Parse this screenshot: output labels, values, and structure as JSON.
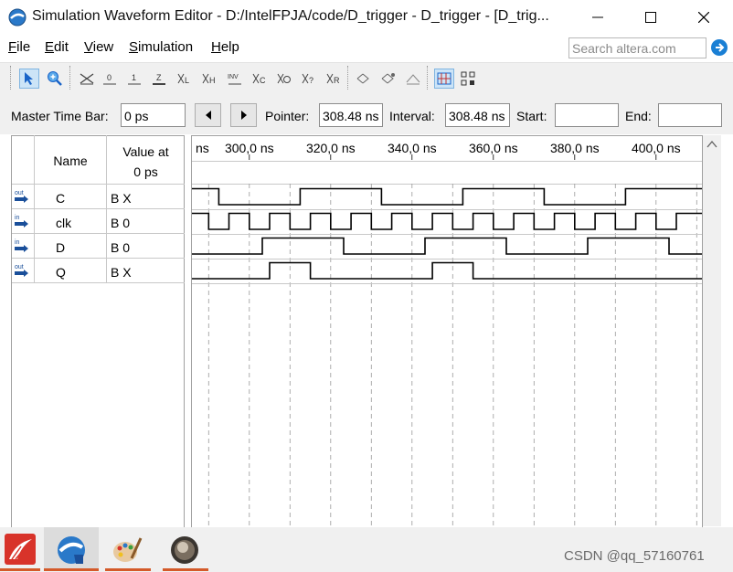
{
  "window": {
    "title": "Simulation Waveform Editor - D:/IntelFPJA/code/D_trigger - D_trigger - [D_trig..."
  },
  "menu": {
    "items": [
      {
        "label": "File",
        "accel": "F"
      },
      {
        "label": "Edit",
        "accel": "E"
      },
      {
        "label": "View",
        "accel": "V"
      },
      {
        "label": "Simulation",
        "accel": "S"
      },
      {
        "label": "Help",
        "accel": "H"
      }
    ]
  },
  "search": {
    "placeholder": "Search altera.com"
  },
  "toolbar": {
    "icons": [
      "pointer-tool-icon",
      "zoom-tool-icon",
      "forcing-unknown-icon",
      "forcing-low-icon",
      "forcing-high-icon",
      "high-impedance-icon",
      "weak-low-icon",
      "weak-high-icon",
      "invert-icon",
      "count-value-icon",
      "clock-value-icon",
      "arbitrary-value-icon",
      "random-value-icon",
      "snap-to-grid-icon",
      "grid-icon",
      "functional-simulation-icon",
      "timing-simulation-icon",
      "netlist-icon"
    ]
  },
  "timebar": {
    "master_label": "Master Time Bar:",
    "master_value": "0 ps",
    "pointer_label": "Pointer:",
    "pointer_value": "308.48 ns",
    "interval_label": "Interval:",
    "interval_value": "308.48 ns",
    "start_label": "Start:",
    "start_value": "",
    "end_label": "End:",
    "end_value": ""
  },
  "table": {
    "name_header": "Name",
    "value_header_line1": "Value at",
    "value_header_line2": "0 ps",
    "signals": [
      {
        "name": "C",
        "value": "B X",
        "direction": "out"
      },
      {
        "name": "clk",
        "value": "B 0",
        "direction": "in"
      },
      {
        "name": "D",
        "value": "B 0",
        "direction": "in"
      },
      {
        "name": "Q",
        "value": "B X",
        "direction": "out"
      }
    ]
  },
  "timeline": {
    "partial_label": "ns",
    "ticks": [
      "300,0 ns",
      "320,0 ns",
      "340,0 ns",
      "360,0 ns",
      "380,0 ns",
      "400,0 ns"
    ]
  },
  "waves": {
    "C": {
      "initial": 1,
      "transitions_ns": [
        292.5,
        312.5,
        332.5,
        352.5,
        372.5,
        392.5
      ]
    },
    "clk": {
      "initial": 1,
      "transitions_ns": [
        285,
        290,
        295,
        300,
        305,
        310,
        315,
        320,
        325,
        330,
        335,
        340,
        345,
        350,
        355,
        360,
        365,
        370,
        375,
        380,
        385,
        390,
        395,
        400,
        405
      ]
    },
    "D": {
      "initial": 0,
      "transitions_ns": [
        303.2,
        323.2,
        343.2,
        363.2,
        383.2,
        403.2
      ]
    },
    "Q": {
      "initial": 0,
      "transitions_ns": [
        285,
        305,
        315,
        345,
        355
      ]
    }
  },
  "watermark": "CSDN @qq_57160761",
  "colors": {
    "accent": "#1a7fd4",
    "wave": "#000000",
    "grid": "#9a9a9a"
  }
}
